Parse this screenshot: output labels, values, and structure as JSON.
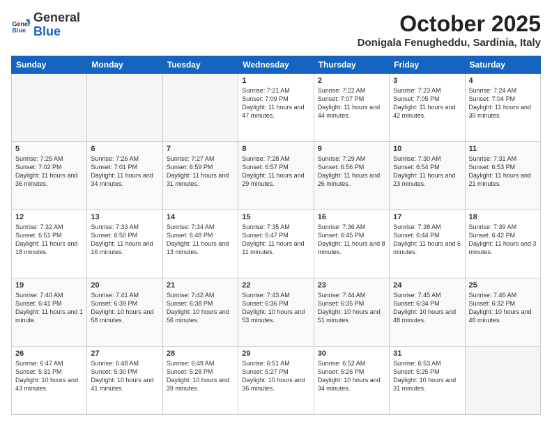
{
  "logo": {
    "general": "General",
    "blue": "Blue"
  },
  "header": {
    "month": "October 2025",
    "location": "Donigala Fenugheddu, Sardinia, Italy"
  },
  "weekdays": [
    "Sunday",
    "Monday",
    "Tuesday",
    "Wednesday",
    "Thursday",
    "Friday",
    "Saturday"
  ],
  "weeks": [
    [
      {
        "day": "",
        "info": ""
      },
      {
        "day": "",
        "info": ""
      },
      {
        "day": "",
        "info": ""
      },
      {
        "day": "1",
        "info": "Sunrise: 7:21 AM\nSunset: 7:09 PM\nDaylight: 11 hours and 47 minutes."
      },
      {
        "day": "2",
        "info": "Sunrise: 7:22 AM\nSunset: 7:07 PM\nDaylight: 11 hours and 44 minutes."
      },
      {
        "day": "3",
        "info": "Sunrise: 7:23 AM\nSunset: 7:05 PM\nDaylight: 11 hours and 42 minutes."
      },
      {
        "day": "4",
        "info": "Sunrise: 7:24 AM\nSunset: 7:04 PM\nDaylight: 11 hours and 39 minutes."
      }
    ],
    [
      {
        "day": "5",
        "info": "Sunrise: 7:25 AM\nSunset: 7:02 PM\nDaylight: 11 hours and 36 minutes."
      },
      {
        "day": "6",
        "info": "Sunrise: 7:26 AM\nSunset: 7:01 PM\nDaylight: 11 hours and 34 minutes."
      },
      {
        "day": "7",
        "info": "Sunrise: 7:27 AM\nSunset: 6:59 PM\nDaylight: 11 hours and 31 minutes."
      },
      {
        "day": "8",
        "info": "Sunrise: 7:28 AM\nSunset: 6:57 PM\nDaylight: 11 hours and 29 minutes."
      },
      {
        "day": "9",
        "info": "Sunrise: 7:29 AM\nSunset: 6:56 PM\nDaylight: 11 hours and 26 minutes."
      },
      {
        "day": "10",
        "info": "Sunrise: 7:30 AM\nSunset: 6:54 PM\nDaylight: 11 hours and 23 minutes."
      },
      {
        "day": "11",
        "info": "Sunrise: 7:31 AM\nSunset: 6:53 PM\nDaylight: 11 hours and 21 minutes."
      }
    ],
    [
      {
        "day": "12",
        "info": "Sunrise: 7:32 AM\nSunset: 6:51 PM\nDaylight: 11 hours and 18 minutes."
      },
      {
        "day": "13",
        "info": "Sunrise: 7:33 AM\nSunset: 6:50 PM\nDaylight: 11 hours and 16 minutes."
      },
      {
        "day": "14",
        "info": "Sunrise: 7:34 AM\nSunset: 6:48 PM\nDaylight: 11 hours and 13 minutes."
      },
      {
        "day": "15",
        "info": "Sunrise: 7:35 AM\nSunset: 6:47 PM\nDaylight: 11 hours and 11 minutes."
      },
      {
        "day": "16",
        "info": "Sunrise: 7:36 AM\nSunset: 6:45 PM\nDaylight: 11 hours and 8 minutes."
      },
      {
        "day": "17",
        "info": "Sunrise: 7:38 AM\nSunset: 6:44 PM\nDaylight: 11 hours and 6 minutes."
      },
      {
        "day": "18",
        "info": "Sunrise: 7:39 AM\nSunset: 6:42 PM\nDaylight: 11 hours and 3 minutes."
      }
    ],
    [
      {
        "day": "19",
        "info": "Sunrise: 7:40 AM\nSunset: 6:41 PM\nDaylight: 11 hours and 1 minute."
      },
      {
        "day": "20",
        "info": "Sunrise: 7:41 AM\nSunset: 6:39 PM\nDaylight: 10 hours and 58 minutes."
      },
      {
        "day": "21",
        "info": "Sunrise: 7:42 AM\nSunset: 6:38 PM\nDaylight: 10 hours and 56 minutes."
      },
      {
        "day": "22",
        "info": "Sunrise: 7:43 AM\nSunset: 6:36 PM\nDaylight: 10 hours and 53 minutes."
      },
      {
        "day": "23",
        "info": "Sunrise: 7:44 AM\nSunset: 6:35 PM\nDaylight: 10 hours and 51 minutes."
      },
      {
        "day": "24",
        "info": "Sunrise: 7:45 AM\nSunset: 6:34 PM\nDaylight: 10 hours and 48 minutes."
      },
      {
        "day": "25",
        "info": "Sunrise: 7:46 AM\nSunset: 6:32 PM\nDaylight: 10 hours and 46 minutes."
      }
    ],
    [
      {
        "day": "26",
        "info": "Sunrise: 6:47 AM\nSunset: 5:31 PM\nDaylight: 10 hours and 43 minutes."
      },
      {
        "day": "27",
        "info": "Sunrise: 6:48 AM\nSunset: 5:30 PM\nDaylight: 10 hours and 41 minutes."
      },
      {
        "day": "28",
        "info": "Sunrise: 6:49 AM\nSunset: 5:28 PM\nDaylight: 10 hours and 39 minutes."
      },
      {
        "day": "29",
        "info": "Sunrise: 6:51 AM\nSunset: 5:27 PM\nDaylight: 10 hours and 36 minutes."
      },
      {
        "day": "30",
        "info": "Sunrise: 6:52 AM\nSunset: 5:26 PM\nDaylight: 10 hours and 34 minutes."
      },
      {
        "day": "31",
        "info": "Sunrise: 6:53 AM\nSunset: 5:25 PM\nDaylight: 10 hours and 31 minutes."
      },
      {
        "day": "",
        "info": ""
      }
    ]
  ]
}
